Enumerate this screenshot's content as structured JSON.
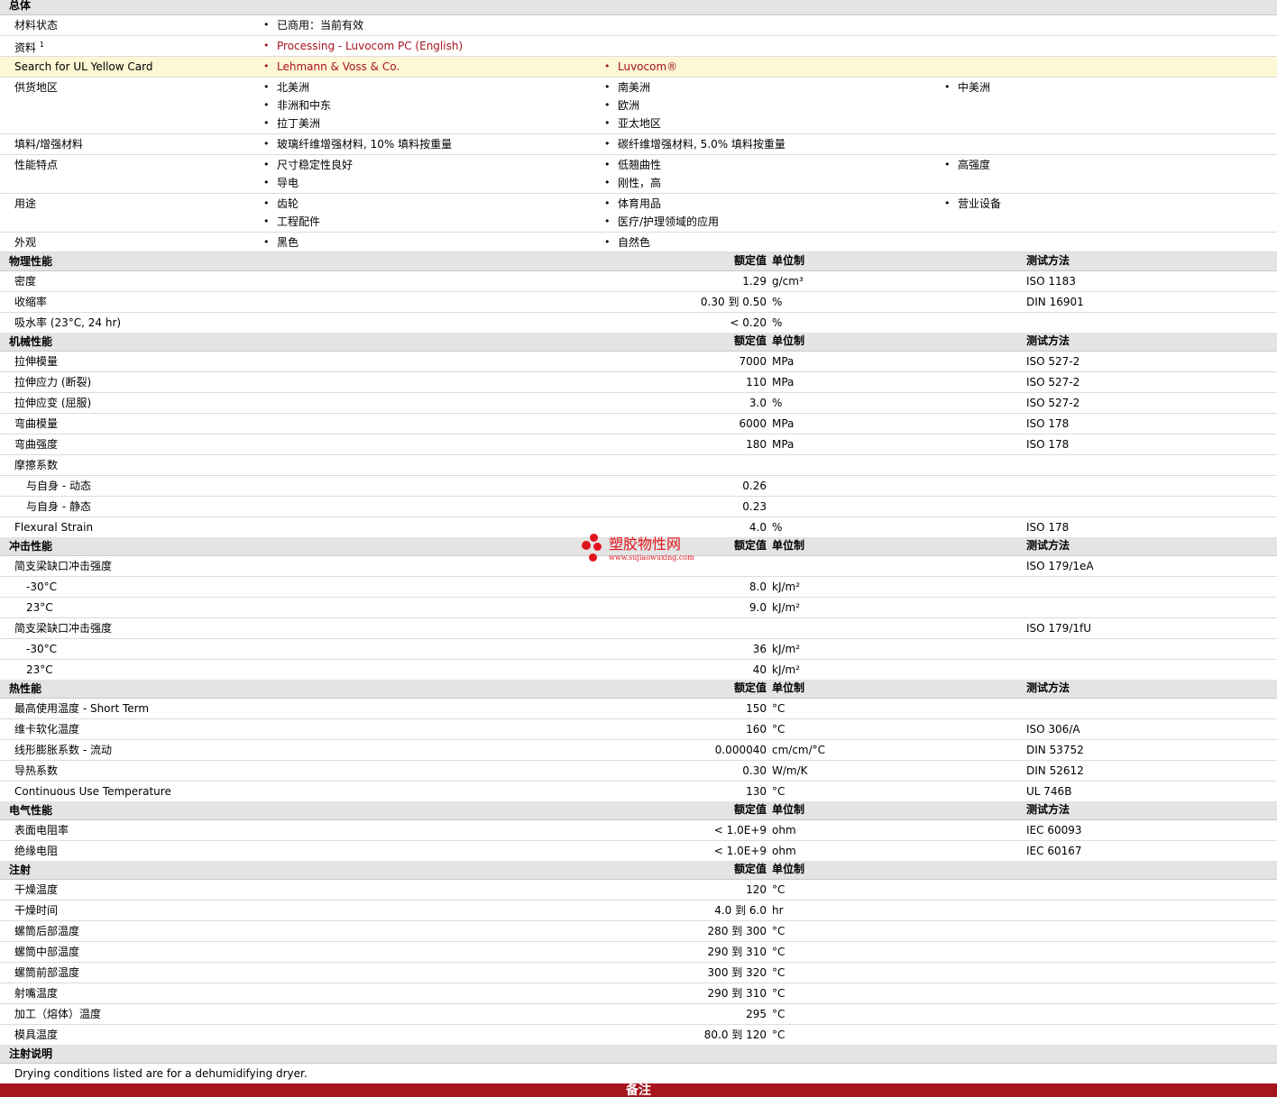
{
  "general": {
    "title": "总体",
    "material_status": {
      "label": "材料状态",
      "value": "已商用：当前有效"
    },
    "docs": {
      "label": "资料",
      "sup": "1",
      "link": "Processing - Luvocom PC (English)"
    },
    "ul": {
      "label": "Search for UL Yellow Card",
      "items": [
        "Lehmann & Voss & Co.",
        "Luvocom®"
      ]
    },
    "supply": {
      "label": "供货地区",
      "col1": [
        "北美洲",
        "非洲和中东",
        "拉丁美洲"
      ],
      "col2": [
        "南美洲",
        "欧洲",
        "亚太地区"
      ],
      "col3": [
        "中美洲"
      ]
    },
    "filler": {
      "label": "填料/增强材料",
      "col1": [
        "玻璃纤维增强材料, 10% 填料按重量"
      ],
      "col2": [
        "碳纤维增强材料, 5.0% 填料按重量"
      ]
    },
    "features": {
      "label": "性能特点",
      "col1": [
        "尺寸稳定性良好",
        "导电"
      ],
      "col2": [
        "低翘曲性",
        "刚性，高"
      ],
      "col3": [
        "高强度"
      ]
    },
    "uses": {
      "label": "用途",
      "col1": [
        "齿轮",
        "工程配件"
      ],
      "col2": [
        "体育用品",
        "医疗/护理领域的应用"
      ],
      "col3": [
        "营业设备"
      ]
    },
    "appearance": {
      "label": "外观",
      "col1": [
        "黑色"
      ],
      "col2": [
        "自然色"
      ]
    }
  },
  "headers": {
    "value": "额定值",
    "unit": "单位制",
    "test": "测试方法"
  },
  "physical": {
    "title": "物理性能",
    "rows": [
      {
        "label": "密度",
        "value": "1.29",
        "unit": "g/cm³",
        "test": "ISO 1183"
      },
      {
        "label": "收缩率",
        "value": "0.30 到  0.50",
        "unit": "%",
        "test": "DIN 16901"
      },
      {
        "label": "吸水率  (23°C, 24 hr)",
        "value": "< 0.20",
        "unit": "%",
        "test": ""
      }
    ]
  },
  "mechanical": {
    "title": "机械性能",
    "rows": [
      {
        "label": "拉伸模量",
        "value": "7000",
        "unit": "MPa",
        "test": "ISO 527-2"
      },
      {
        "label": "拉伸应力  (断裂)",
        "value": "110",
        "unit": "MPa",
        "test": "ISO 527-2"
      },
      {
        "label": "拉伸应变  (屈服)",
        "value": "3.0",
        "unit": "%",
        "test": "ISO 527-2"
      },
      {
        "label": "弯曲模量",
        "value": "6000",
        "unit": "MPa",
        "test": "ISO 178"
      },
      {
        "label": "弯曲强度",
        "value": "180",
        "unit": "MPa",
        "test": "ISO 178"
      },
      {
        "label": "摩擦系数",
        "value": "",
        "unit": "",
        "test": ""
      },
      {
        "label": "与自身  - 动态",
        "value": "0.26",
        "unit": "",
        "test": "",
        "sub": true
      },
      {
        "label": "与自身  - 静态",
        "value": "0.23",
        "unit": "",
        "test": "",
        "sub": true
      },
      {
        "label": "Flexural Strain",
        "value": "4.0",
        "unit": "%",
        "test": "ISO 178"
      }
    ]
  },
  "impact": {
    "title": "冲击性能",
    "rows": [
      {
        "label": "简支梁缺口冲击强度",
        "value": "",
        "unit": "",
        "test": "ISO 179/1eA"
      },
      {
        "label": "-30°C",
        "value": "8.0",
        "unit": "kJ/m²",
        "test": "",
        "sub": true
      },
      {
        "label": "23°C",
        "value": "9.0",
        "unit": "kJ/m²",
        "test": "",
        "sub": true
      },
      {
        "label": "简支梁缺口冲击强度",
        "value": "",
        "unit": "",
        "test": "ISO 179/1fU"
      },
      {
        "label": "-30°C",
        "value": "36",
        "unit": "kJ/m²",
        "test": "",
        "sub": true
      },
      {
        "label": "23°C",
        "value": "40",
        "unit": "kJ/m²",
        "test": "",
        "sub": true
      }
    ]
  },
  "thermal": {
    "title": "热性能",
    "rows": [
      {
        "label": "最高使用温度  - Short Term",
        "value": "150",
        "unit": "°C",
        "test": ""
      },
      {
        "label": "维卡软化温度",
        "value": "160",
        "unit": "°C",
        "test": "ISO 306/A"
      },
      {
        "label": "线形膨胀系数  - 流动",
        "value": "0.000040",
        "unit": "cm/cm/°C",
        "test": "DIN 53752"
      },
      {
        "label": "导热系数",
        "value": "0.30",
        "unit": "W/m/K",
        "test": "DIN 52612"
      },
      {
        "label": "Continuous Use Temperature",
        "value": "130",
        "unit": "°C",
        "test": "UL 746B"
      }
    ]
  },
  "electrical": {
    "title": "电气性能",
    "rows": [
      {
        "label": "表面电阻率",
        "value": "< 1.0E+9",
        "unit": "ohm",
        "test": "IEC 60093"
      },
      {
        "label": "绝缘电阻",
        "value": "< 1.0E+9",
        "unit": "ohm",
        "test": "IEC 60167"
      }
    ]
  },
  "injection": {
    "title": "注射",
    "rows": [
      {
        "label": "干燥温度",
        "value": "120",
        "unit": "°C"
      },
      {
        "label": "干燥时间",
        "value": "4.0 到  6.0",
        "unit": "hr"
      },
      {
        "label": "螺筒后部温度",
        "value": "280 到  300",
        "unit": "°C"
      },
      {
        "label": "螺筒中部温度",
        "value": "290 到  310",
        "unit": "°C"
      },
      {
        "label": "螺筒前部温度",
        "value": "300 到  320",
        "unit": "°C"
      },
      {
        "label": "射嘴温度",
        "value": "290 到  310",
        "unit": "°C"
      },
      {
        "label": "加工（熔体）温度",
        "value": "295",
        "unit": "°C"
      },
      {
        "label": "模具温度",
        "value": "80.0 到  120",
        "unit": "°C"
      }
    ]
  },
  "injection_notes": {
    "title": "注射说明",
    "text": "Drying conditions listed are for a dehumidifying dryer."
  },
  "watermark": {
    "title": "塑胶物性网",
    "url": "www.sujiaowuxing.com"
  },
  "footer": {
    "title": "备注"
  },
  "colors": {
    "brand_red": "#a6141e",
    "watermark_red": "#e2141b",
    "section_grey": "#e4e4e4",
    "highlight_yellow": "#fcf7d4"
  }
}
